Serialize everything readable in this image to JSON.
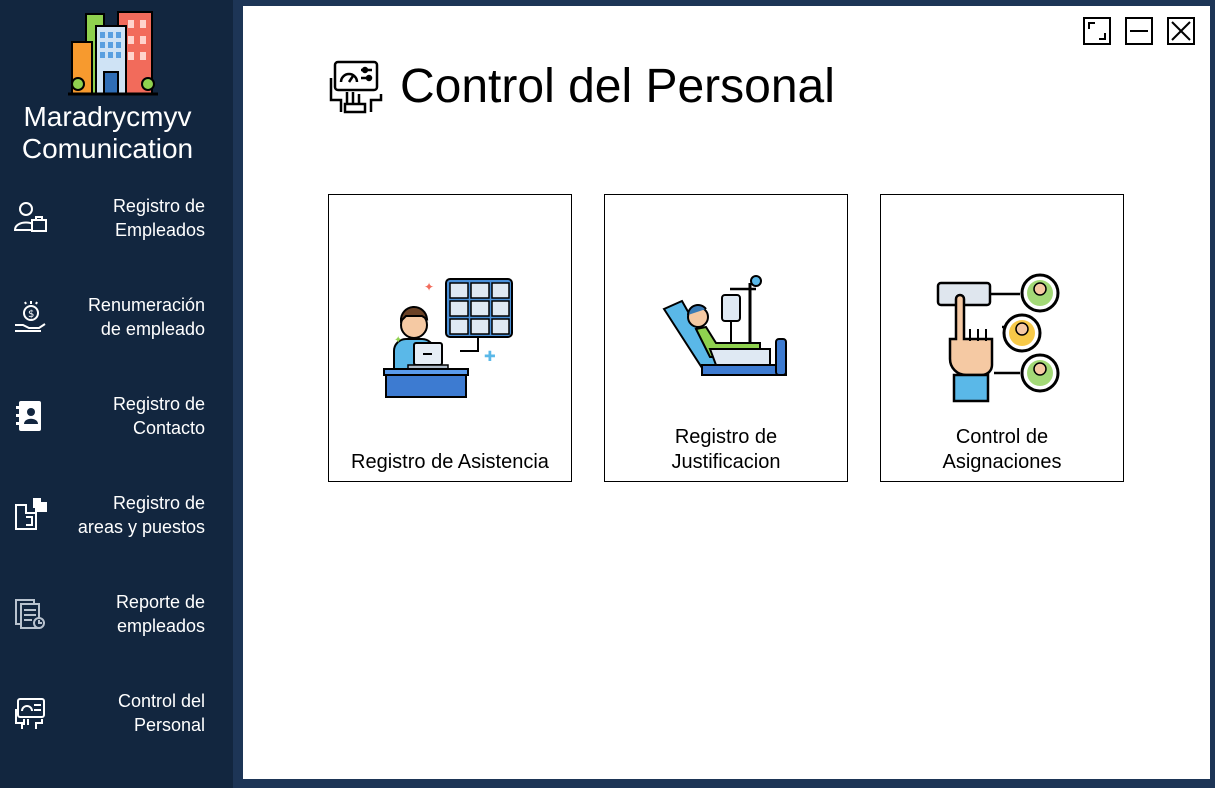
{
  "brand": {
    "name": "Maradrycmyv\nComunication"
  },
  "sidebar": {
    "items": [
      {
        "label": "Registro de \nEmpleados",
        "icon": "employee-briefcase-icon"
      },
      {
        "label": "Renumeración\nde empleado",
        "icon": "salary-hand-coin-icon"
      },
      {
        "label": "Registro de \nContacto",
        "icon": "contact-book-icon"
      },
      {
        "label": "Registro de \nareas y puestos",
        "icon": "puzzle-areas-icon"
      },
      {
        "label": "Reporte de \nempleados",
        "icon": "report-documents-icon"
      },
      {
        "label": "Control del \nPersonal",
        "icon": "control-panel-icon"
      }
    ]
  },
  "window": {
    "buttons": [
      {
        "icon": "maximize-icon"
      },
      {
        "icon": "minimize-icon"
      },
      {
        "icon": "close-icon"
      }
    ]
  },
  "main": {
    "title": "Control del Personal",
    "title_icon": "control-panel-icon",
    "cards": [
      {
        "label": "Registro de Asistencia",
        "icon": "video-attendance-icon"
      },
      {
        "label": "Registro de\nJustificacion",
        "icon": "patient-iv-icon"
      },
      {
        "label": "Control de\nAsignaciones",
        "icon": "assignment-hand-icon"
      }
    ]
  },
  "colors": {
    "sidebar_bg": "#12263f",
    "frame_bg": "#1d3556",
    "content_bg": "#ffffff",
    "text_light": "#ffffff"
  }
}
